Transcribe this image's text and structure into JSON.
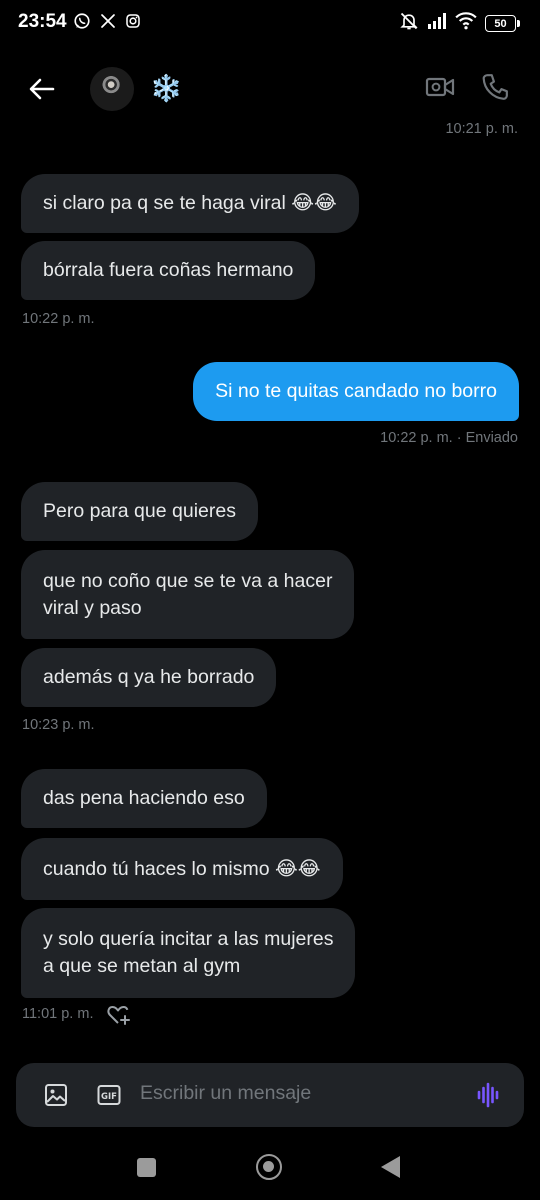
{
  "status_bar": {
    "time": "23:54",
    "app_icons": [
      "whatsapp-icon",
      "x-icon",
      "instagram-icon"
    ],
    "right_icons": [
      "mute-bell-icon",
      "signal-icon",
      "wifi-icon"
    ],
    "battery": "50"
  },
  "header": {
    "contact_name": "❄️",
    "actions": [
      "video-call-icon",
      "phone-icon"
    ]
  },
  "conversation": {
    "top_timestamp": "10:21 p. m.",
    "groups": [
      {
        "side": "in",
        "messages": [
          "si claro pa q se te haga viral 😂😂",
          "bórrala fuera coñas hermano"
        ],
        "timestamp": "10:22 p. m."
      },
      {
        "side": "out",
        "messages": [
          "Si no te quitas candado no borro"
        ],
        "timestamp": "10:22 p. m. · Enviado"
      },
      {
        "side": "in",
        "messages": [
          "Pero para que quieres",
          "que no coño que se te va a hacer\nviral y paso",
          "además q ya he borrado"
        ],
        "timestamp": "10:23 p. m."
      },
      {
        "side": "in",
        "messages": [
          "das pena haciendo eso",
          "cuando tú haces lo mismo 😂😂",
          "y solo quería incitar a las mujeres\na que se metan al gym"
        ],
        "timestamp": "11:01 p. m."
      }
    ]
  },
  "composer": {
    "placeholder": "Escribir un mensaje",
    "gif_label": "GIF"
  },
  "colors": {
    "background": "#000000",
    "incoming_bubble": "#202327",
    "outgoing_bubble": "#1d9bf0",
    "timestamp": "#71767b",
    "voice_accent": "#7856ff"
  }
}
